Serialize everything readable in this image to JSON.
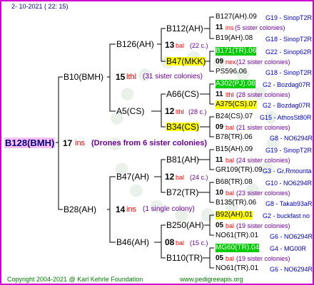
{
  "header": {
    "date": "2- 10-2021 ( 22: 15)"
  },
  "footer": {
    "copyright": "Copyright 2004-2021 @ Karl Kehrle Foundation",
    "url": "www.pedigreeapis.org"
  },
  "colors": {
    "frame": "#d000d0",
    "root_bg": "#ffc0ff",
    "line": "#000000",
    "yellow_hl": "#ffff00",
    "green_hl": "#00cc00",
    "count": "#ff0000",
    "note": "#7000a0",
    "code": "#0000cc"
  },
  "root": {
    "label": "B128(BMH)",
    "count": "17",
    "ins": "ins",
    "note": "(Drones from 6 sister colonies)"
  },
  "gen1": [
    {
      "label": "B10(BMH)",
      "count": "15",
      "ins": "lthl",
      "note": "(31 sister colonies)"
    },
    {
      "label": "B28(AH)",
      "count": "14",
      "ins": "ins",
      "note": "(1 single colony)"
    }
  ],
  "gen2": [
    {
      "label": "B126(AH)"
    },
    {
      "label": "A5(CS)"
    },
    {
      "label": "B47(AH)"
    },
    {
      "label": "B46(AH)"
    }
  ],
  "gen3": [
    {
      "label": "B112(AH)",
      "count": "13",
      "ins": "bal",
      "note": "(22 c.)"
    },
    {
      "label": "B47(MKK)",
      "count": "",
      "ins": "",
      "note": ""
    },
    {
      "label": "A66(CS)",
      "count": "",
      "ins": "",
      "note": ""
    },
    {
      "label": "B34(CS)",
      "count": "12",
      "ins": "lthl",
      "note": "(28 c.)"
    },
    {
      "label": "B81(AH)",
      "count": "12",
      "ins": "bal",
      "note": "(24 c.)"
    },
    {
      "label": "B72(TR)",
      "count": "",
      "ins": "",
      "note": ""
    },
    {
      "label": "B250(AH)",
      "count": "",
      "ins": "",
      "note": ""
    },
    {
      "label": "B110(TR)",
      "count": "08",
      "ins": "bal",
      "note": "(15 c.)"
    }
  ],
  "gen4": [
    {
      "label": "B127(AH).09",
      "code": "G19 - SinopT2R"
    },
    {
      "count": "11",
      "ins": "ins",
      "note": "(5 sister colonies)"
    },
    {
      "label": "B19(AH).08",
      "code": "G18 - SinopT2R"
    },
    {
      "label": "B171(TR).06",
      "code": "G22 - Sinop62R"
    },
    {
      "count": "09",
      "ins": "nex",
      "note": "(12 sister colonies)"
    },
    {
      "label": "PS596.06",
      "code": "G18 - SinopT2R"
    },
    {
      "label": "A302(PJ).08",
      "code": "G2 - Bozdag07R"
    },
    {
      "count": "11",
      "ins": "lthl",
      "note": "(28 sister colonies)"
    },
    {
      "label": "A375(CS).07",
      "code": "G2 - Bozdag07R"
    },
    {
      "label": "B24(CS).07",
      "code": "G15 - AthosSt80R"
    },
    {
      "count": "09",
      "ins": "bal",
      "note": "(21 sister colonies)"
    },
    {
      "label": "B78(TR).06",
      "code": "G8 - NO6294R"
    },
    {
      "label": "B15(AH).09",
      "code": "G19 - SinopT2R"
    },
    {
      "count": "11",
      "ins": "bal",
      "note": "(24 sister colonies)"
    },
    {
      "label": "GR109(TR).09",
      "code": "G3 - Gr.Rmounta"
    },
    {
      "label": "B68(TR).08",
      "code": "G10 - NO6294R"
    },
    {
      "count": "10",
      "ins": "bal",
      "note": "(23 sister colonies)"
    },
    {
      "label": "B135(TR).06",
      "code": "G8 - Takab93aR"
    },
    {
      "label": "B92(AH).01",
      "code": "G2 - buckfast no"
    },
    {
      "count": "05",
      "ins": "bal",
      "note": "(19 sister colonies)"
    },
    {
      "label": "NO61(TR).01",
      "code": "G6 - NO6294R"
    },
    {
      "label": "MG60(TR).04",
      "code": "G4 - MG00R"
    },
    {
      "count": "05",
      "ins": "bal",
      "note": "(19 sister colonies)"
    },
    {
      "label": "NO61(TR).01",
      "code": "G6 - NO6294R"
    }
  ]
}
